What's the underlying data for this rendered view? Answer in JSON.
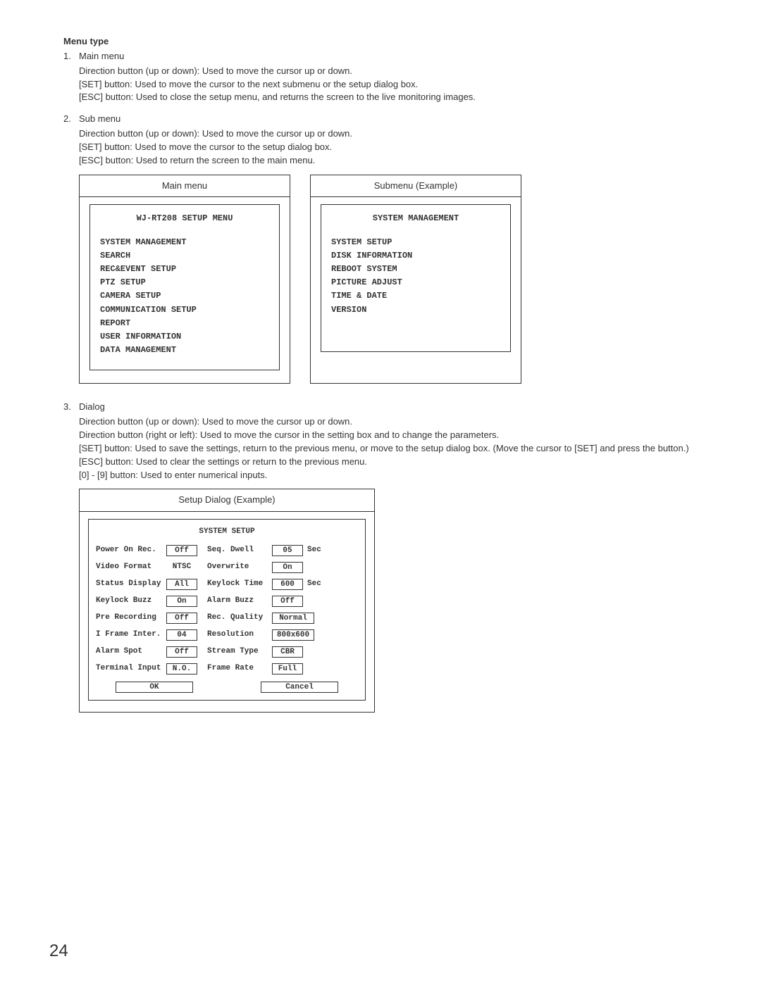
{
  "heading": "Menu type",
  "section1": {
    "num": "1.",
    "title": "Main menu",
    "lines": [
      "Direction button (up or down): Used to move the cursor up or down.",
      "[SET] button: Used to move the cursor to the next submenu or the setup dialog box.",
      "[ESC] button: Used to close the setup menu, and returns the screen to the live monitoring images."
    ]
  },
  "section2": {
    "num": "2.",
    "title": "Sub menu",
    "lines": [
      "Direction button (up or down): Used to move the cursor up or down.",
      "[SET] button: Used to move the cursor to the setup dialog box.",
      "[ESC] button: Used to return the screen to the main menu."
    ]
  },
  "main_menu": {
    "caption": "Main menu",
    "title": "WJ-RT208 SETUP MENU",
    "items": [
      "SYSTEM MANAGEMENT",
      "SEARCH",
      "REC&EVENT SETUP",
      "PTZ SETUP",
      "CAMERA SETUP",
      "COMMUNICATION SETUP",
      "REPORT",
      "USER INFORMATION",
      "DATA MANAGEMENT"
    ]
  },
  "sub_menu": {
    "caption": "Submenu (Example)",
    "title": "SYSTEM MANAGEMENT",
    "items": [
      "SYSTEM SETUP",
      "DISK INFORMATION",
      "REBOOT SYSTEM",
      "PICTURE ADJUST",
      "TIME & DATE",
      "VERSION"
    ]
  },
  "section3": {
    "num": "3.",
    "title": "Dialog",
    "lines": [
      "Direction button (up or down): Used to move the cursor up or down.",
      "Direction button (right or left): Used to move the cursor in the setting box and to change the parameters."
    ],
    "wrapline": "[SET] button: Used to save the settings, return to the previous menu, or move to the setup dialog box. (Move the cursor to [SET] and press the button.)",
    "lines2": [
      "[ESC] button: Used to clear the settings or return to the previous menu.",
      "[0] - [9] button: Used to enter numerical inputs."
    ]
  },
  "dialog": {
    "caption": "Setup Dialog (Example)",
    "title": "SYSTEM SETUP",
    "rows": [
      {
        "l1": "Power On Rec.",
        "v1": "Off",
        "l2": "Seq. Dwell",
        "v2": "05",
        "u": "Sec"
      },
      {
        "l1": "Video Format",
        "v1": "NTSC",
        "noBox1": true,
        "l2": "Overwrite",
        "v2": "On",
        "u": ""
      },
      {
        "l1": "Status Display",
        "v1": "All",
        "l2": "Keylock Time",
        "v2": "600",
        "u": "Sec"
      },
      {
        "l1": "Keylock Buzz",
        "v1": "On",
        "l2": "Alarm Buzz",
        "v2": "Off",
        "u": ""
      },
      {
        "l1": "Pre Recording",
        "v1": "Off",
        "l2": "Rec. Quality",
        "v2": "Normal",
        "u": "",
        "wide2": true
      },
      {
        "l1": "I Frame Inter.",
        "v1": "04",
        "l2": "Resolution",
        "v2": "800x600",
        "u": "",
        "wide2": true
      },
      {
        "l1": "Alarm Spot",
        "v1": "Off",
        "l2": "Stream Type",
        "v2": "CBR",
        "u": ""
      },
      {
        "l1": "Terminal Input",
        "v1": "N.O.",
        "l2": "Frame Rate",
        "v2": "Full",
        "u": ""
      }
    ],
    "ok": "OK",
    "cancel": "Cancel"
  },
  "page_number": "24"
}
